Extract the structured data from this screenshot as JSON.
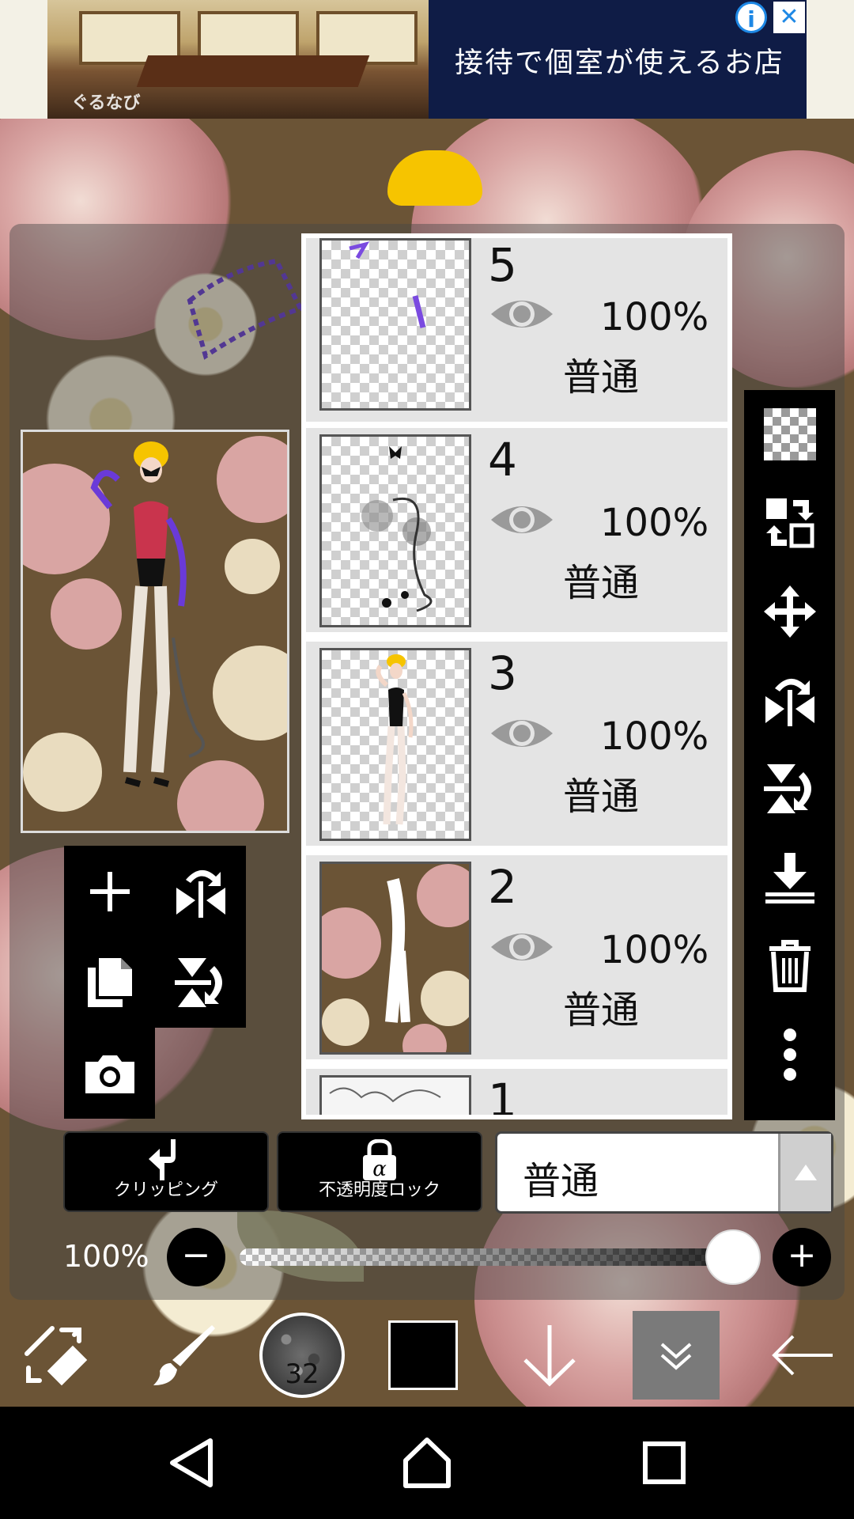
{
  "ad": {
    "text": "接待で個室が使えるお店",
    "logo": "ぐるなび",
    "info_icon": "i",
    "close_icon": "✕"
  },
  "layers": [
    {
      "number": "5",
      "opacity": "100%",
      "mode": "普通",
      "visible": true
    },
    {
      "number": "4",
      "opacity": "100%",
      "mode": "普通",
      "visible": true
    },
    {
      "number": "3",
      "opacity": "100%",
      "mode": "普通",
      "visible": true
    },
    {
      "number": "2",
      "opacity": "100%",
      "mode": "普通",
      "visible": true
    },
    {
      "number": "1"
    }
  ],
  "right_tools": [
    "checkerboard-icon",
    "swap-layer-icon",
    "move-icon",
    "flip-horizontal-icon",
    "flip-vertical-icon",
    "merge-down-icon",
    "trash-icon",
    "more-vert-icon"
  ],
  "left_tools": [
    "add-layer-icon",
    "flip-horizontal-icon",
    "copy-layer-icon",
    "flip-vertical-icon",
    "camera-icon"
  ],
  "controls": {
    "clipping_label": "クリッピング",
    "alpha_lock_label": "不透明度ロック",
    "alpha_symbol": "α",
    "blend_mode": "普通",
    "opacity_value": "100%",
    "opacity_fraction": 1.0,
    "minus": "−",
    "plus": "+"
  },
  "bottom_bar": {
    "brush_size": "32",
    "current_color": "#000000"
  },
  "colors": {
    "panel": "#000000",
    "layer_row": "#e4e4e4",
    "background_brown": "#6b5436",
    "rose_pink": "#d9a5a3"
  }
}
